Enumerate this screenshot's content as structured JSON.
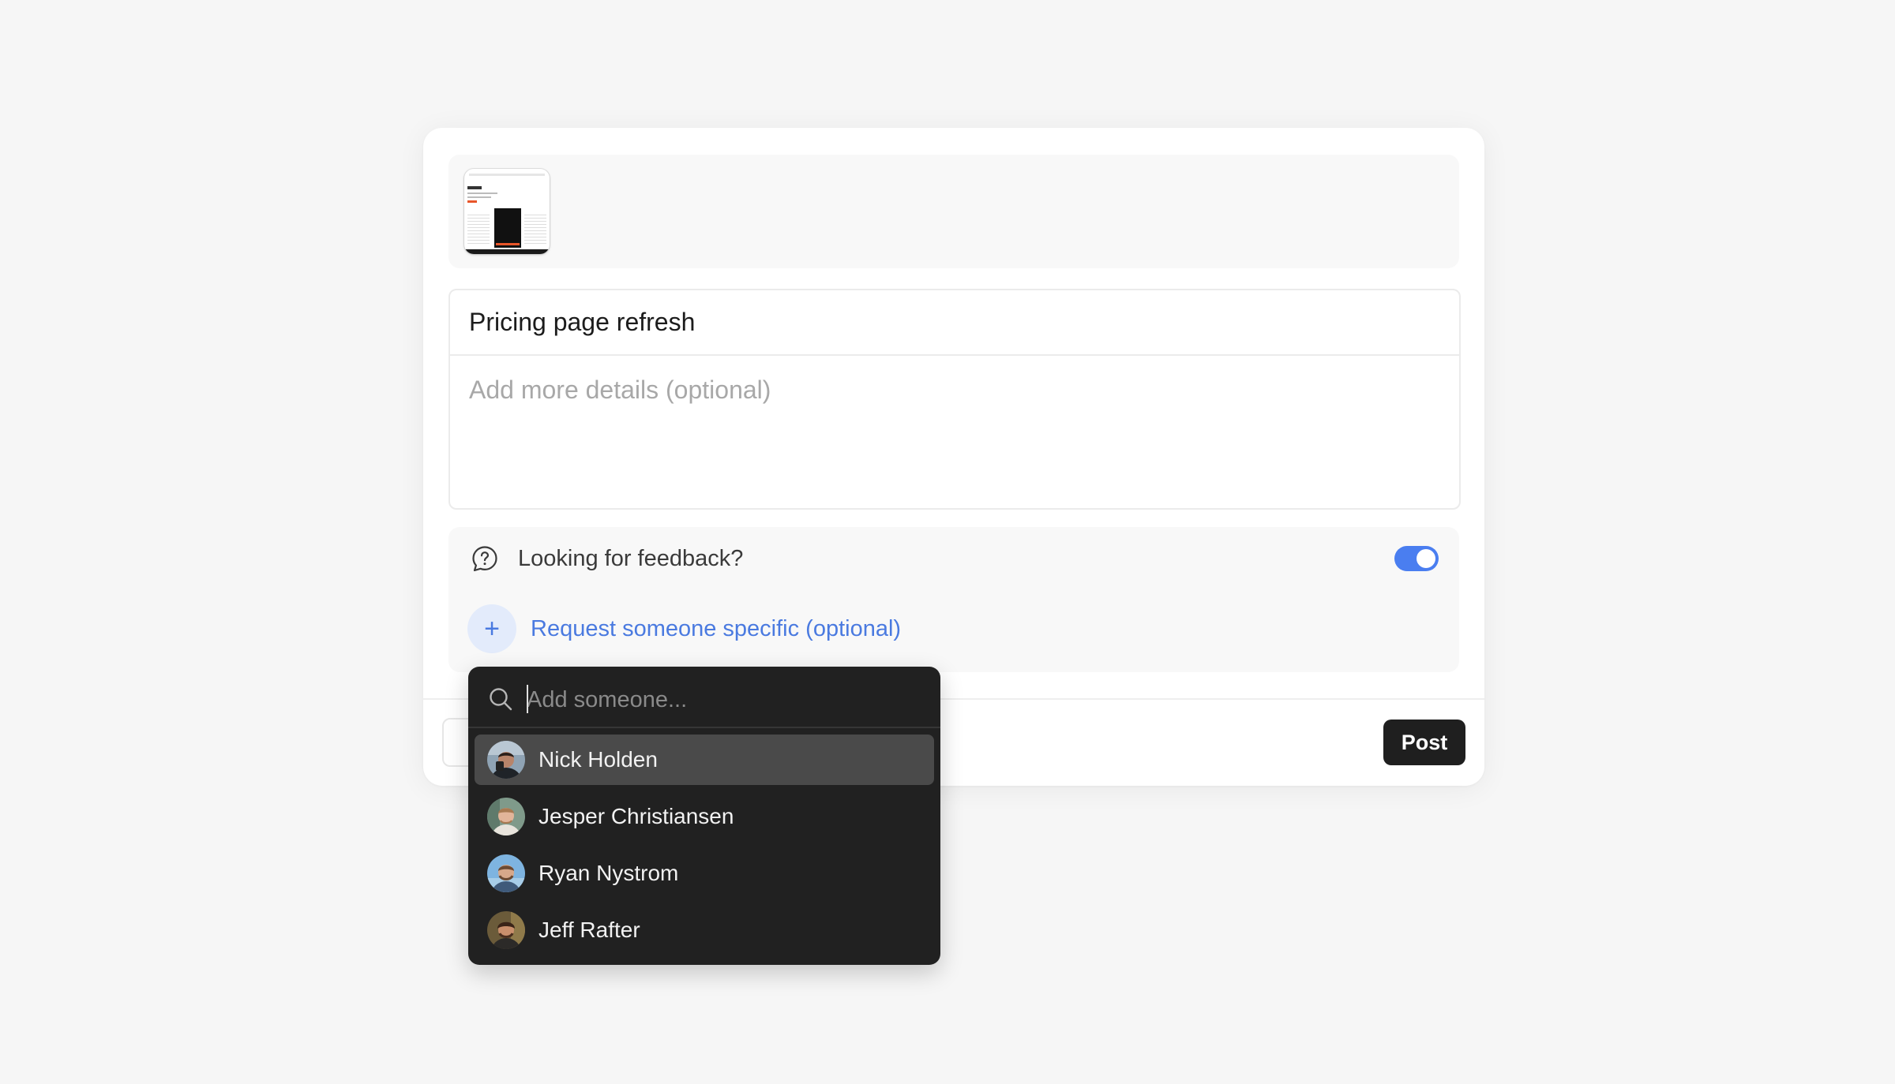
{
  "composer": {
    "title": "Pricing page refresh",
    "details_placeholder": "Add more details (optional)"
  },
  "attachment": {
    "icon": "image-thumbnail"
  },
  "feedback": {
    "label": "Looking for feedback?",
    "toggle_on": true,
    "toggle_color": "#4a7ef0",
    "request_label": "Request someone specific (optional)",
    "plus_symbol": "+"
  },
  "footer": {
    "post_label": "Post"
  },
  "dropdown": {
    "search_placeholder": "Add someone...",
    "people": [
      {
        "name": "Nick Holden",
        "active": true
      },
      {
        "name": "Jesper Christiansen",
        "active": false
      },
      {
        "name": "Ryan Nystrom",
        "active": false
      },
      {
        "name": "Jeff Rafter",
        "active": false
      }
    ]
  }
}
